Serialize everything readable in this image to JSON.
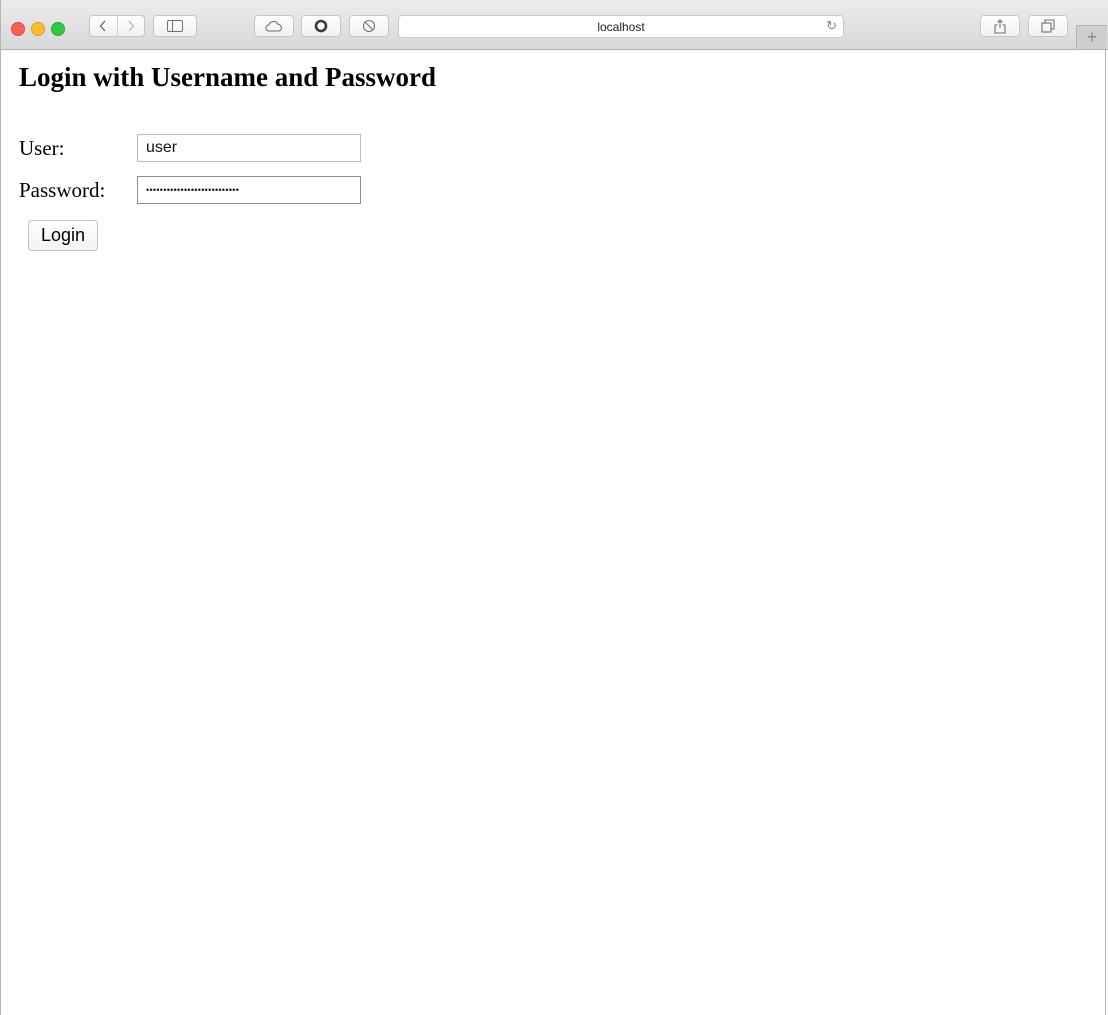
{
  "browser": {
    "address": "localhost",
    "icons": {
      "back": "chevron-left-icon",
      "forward": "chevron-right-icon",
      "sidebar": "sidebar-icon",
      "icloud": "cloud-icon",
      "reader": "circle-icon",
      "ghostery": "blocker-icon",
      "reload": "reload-icon",
      "share": "share-icon",
      "tabs": "tabs-icon",
      "new_tab": "plus-icon"
    }
  },
  "page": {
    "title": "Login with Username and Password",
    "user_label": "User:",
    "user_value": "user",
    "password_label": "Password:",
    "password_value": "•••••••••••••••••••••••••••",
    "login_button": "Login"
  }
}
